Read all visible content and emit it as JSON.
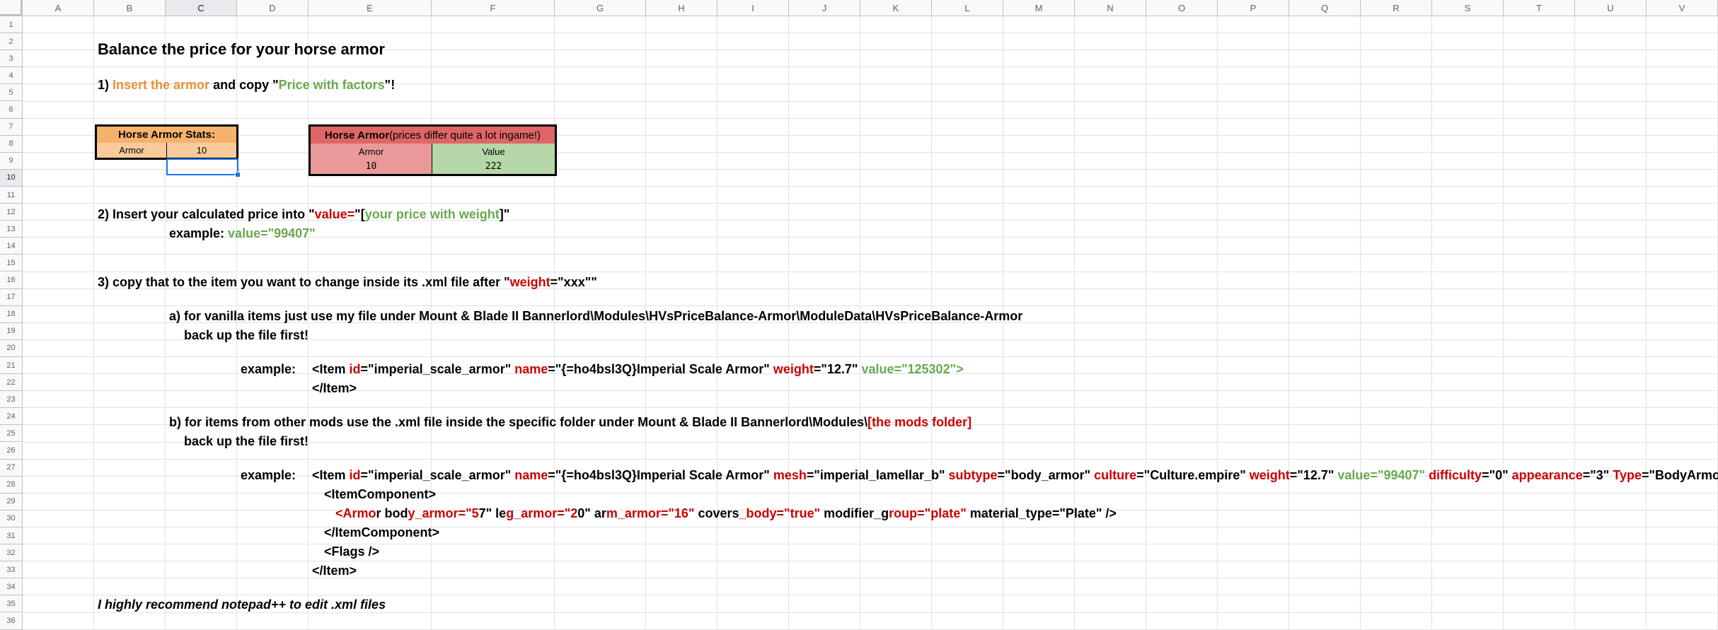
{
  "grid": {
    "columns": [
      "A",
      "B",
      "C",
      "D",
      "E",
      "F",
      "G",
      "H",
      "I",
      "J",
      "K",
      "L",
      "M",
      "N",
      "O",
      "P",
      "Q",
      "R",
      "S",
      "T",
      "U",
      "V"
    ],
    "rows": [
      "1",
      "2",
      "3",
      "4",
      "5",
      "6",
      "7",
      "8",
      "9",
      "10",
      "11",
      "12",
      "13",
      "14",
      "15",
      "16",
      "17",
      "18",
      "19",
      "20",
      "21",
      "22",
      "23",
      "24",
      "25",
      "26",
      "27",
      "28",
      "29",
      "30",
      "31",
      "32",
      "33",
      "34",
      "35",
      "36"
    ],
    "selected_column": "C",
    "selected_row": "10"
  },
  "title": "Balance the price for your horse armor",
  "step1": {
    "prefix": "1) ",
    "insert": "Insert the armor",
    "middle": " and copy \"",
    "price": "Price with factors",
    "end": "\"!"
  },
  "stats_table": {
    "title": "Horse Armor Stats:",
    "label": "Armor",
    "value": "10"
  },
  "price_table": {
    "title_bold": "Horse Armor",
    "title_rest": " (prices differ quite a lot ingame!)",
    "col1": "Armor",
    "col2": "Value",
    "val1": "10",
    "val2": "222"
  },
  "step2": {
    "prefix": "2) Insert your calculated price into \"",
    "value_kw": "value=",
    "quote_open": "\"[",
    "your_price": "your price with weight",
    "close": "]\"",
    "example_label": "example: ",
    "example_value": "value=\"99407\""
  },
  "step3": {
    "prefix": "3) copy that to the item you want to change inside its .xml file after \"",
    "weight_kw": "weight",
    "suffix": "=\"xxx\"\""
  },
  "step3a": {
    "line1": "a) for vanilla items just use my file under Mount & Blade II Bannerlord\\Modules\\HVsPriceBalance-Armor\\ModuleData\\HVsPriceBalance-Armor",
    "line2": "back up the file first!",
    "example_label": "example:",
    "ex1": {
      "p1": "<Item ",
      "id_kw": "id",
      "p2": "=\"imperial_scale_armor\" ",
      "name_kw": "name",
      "p3": "=\"{=ho4bsl3Q}Imperial Scale Armor\" ",
      "weight_kw": "weight",
      "p4": "=\"12.7\" ",
      "value_part": "value=\"125302\">"
    },
    "ex1_close": "</Item>"
  },
  "step3b": {
    "line1_prefix": "b) for items from other mods use the .xml file inside the specific folder under Mount & Blade II Bannerlord\\Modules\\",
    "line1_red": "[the mods folder]",
    "line2": "back up the file first!",
    "example_label": "example:",
    "ex": {
      "p1": "<Item ",
      "id_kw": "id",
      "p2": "=\"imperial_scale_armor\" ",
      "name_kw": "name",
      "p3": "=\"{=ho4bsl3Q}Imperial Scale Armor\" ",
      "mesh_kw": "mesh",
      "p4": "=\"imperial_lamellar_b\" ",
      "subtype_kw": "subtype",
      "p5": "=\"body_armor\" ",
      "culture_kw": "culture",
      "p6": "=\"Culture.empire\" ",
      "weight_kw": "weight",
      "p7": "=\"12.7\" ",
      "value_part": "value=\"99407\" ",
      "difficulty_kw": "difficulty",
      "p8": "=\"0\" ",
      "appearance_kw": "appearance",
      "p9": "=\"3\" ",
      "type_kw": "Type",
      "p10": "=\"BodyArmor\">"
    },
    "line_component_open": "<ItemComponent>",
    "armor_line": [
      {
        "t": "<Armo",
        "c": "red"
      },
      {
        "t": "r bod",
        "c": ""
      },
      {
        "t": "y_armor=\"5",
        "c": "red"
      },
      {
        "t": "7\" le",
        "c": ""
      },
      {
        "t": "g_armor=\"2",
        "c": "red"
      },
      {
        "t": "0\" ar",
        "c": ""
      },
      {
        "t": "m_armor=\"16\"",
        "c": "red"
      },
      {
        "t": " covers",
        "c": ""
      },
      {
        "t": "_body=\"true\"",
        "c": "red"
      },
      {
        "t": " mo",
        "c": ""
      },
      {
        "t": "difier_g",
        "c": ""
      },
      {
        "t": "roup=\"plate\"",
        "c": "red"
      },
      {
        "t": " m",
        "c": ""
      },
      {
        "t": "aterial_type=\"Plate\" />",
        "c": ""
      }
    ],
    "line_component_close": "</ItemComponent>",
    "line_flags": "<Flags />",
    "line_item_close": "</Item>"
  },
  "footer": "I highly recommend notepad++ to edit .xml files"
}
